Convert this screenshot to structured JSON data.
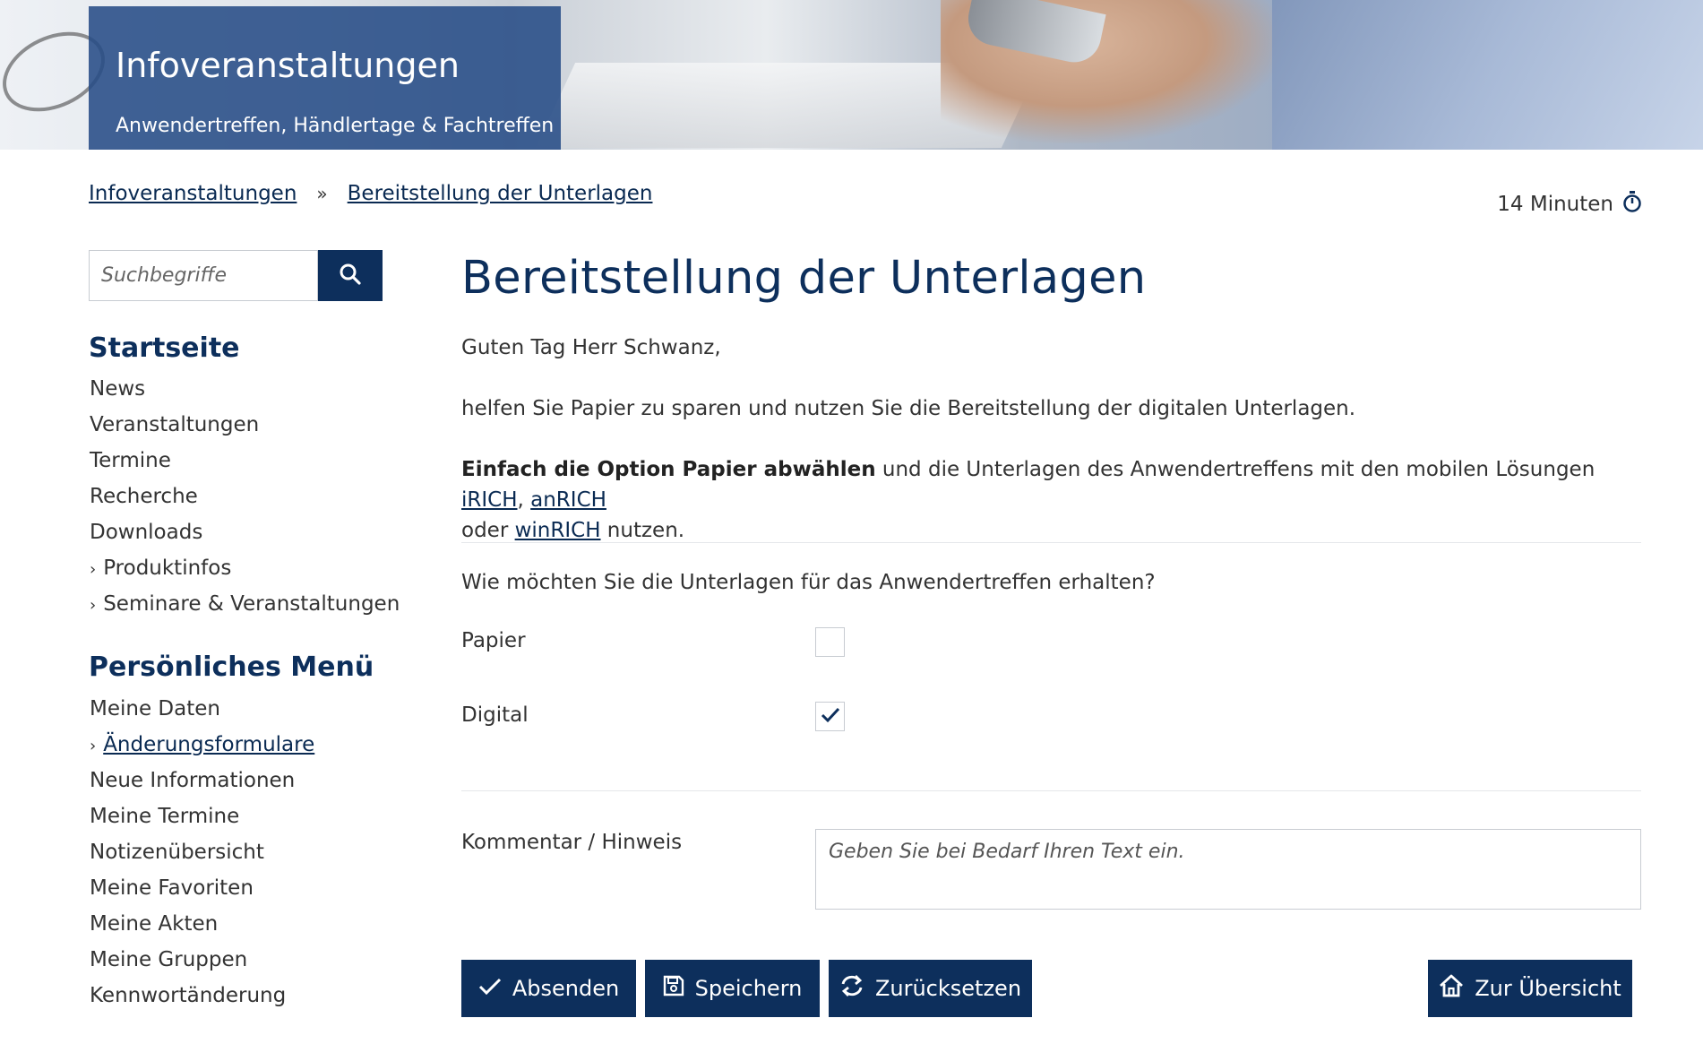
{
  "hero": {
    "title": "Infoveranstaltungen",
    "subtitle": "Anwendertreffen, Händlertage & Fachtreffen"
  },
  "breadcrumb": {
    "items": [
      "Infoveranstaltungen",
      "Bereitstellung der Unterlagen"
    ],
    "separator": "»"
  },
  "timer": {
    "label": "14 Minuten",
    "icon": "stopwatch-icon"
  },
  "search": {
    "placeholder": "Suchbegriffe",
    "icon": "search-icon"
  },
  "sidebar": {
    "main_heading": "Startseite",
    "main_items": [
      {
        "label": "News",
        "chevron": false
      },
      {
        "label": "Veranstaltungen",
        "chevron": false
      },
      {
        "label": "Termine",
        "chevron": false
      },
      {
        "label": "Recherche",
        "chevron": false
      },
      {
        "label": "Downloads",
        "chevron": false
      },
      {
        "label": "Produktinfos",
        "chevron": true
      },
      {
        "label": "Seminare & Veranstaltungen",
        "chevron": true
      }
    ],
    "personal_heading": "Persönliches Menü",
    "personal_items": [
      {
        "label": "Meine Daten",
        "chevron": false
      },
      {
        "label": "Änderungsformulare",
        "chevron": true,
        "active": true
      },
      {
        "label": "Neue Informationen",
        "chevron": false
      },
      {
        "label": "Meine Termine",
        "chevron": false
      },
      {
        "label": "Notizenübersicht",
        "chevron": false
      },
      {
        "label": "Meine Favoriten",
        "chevron": false
      },
      {
        "label": "Meine Akten",
        "chevron": false
      },
      {
        "label": "Meine Gruppen",
        "chevron": false
      },
      {
        "label": "Kennwortänderung",
        "chevron": false
      }
    ],
    "chevron_glyph": "›"
  },
  "main": {
    "title": "Bereitstellung der Unterlagen",
    "greeting": "Guten Tag Herr Schwanz,",
    "intro": "helfen Sie Papier zu sparen und nutzen Sie die Bereitstellung der digitalen Unterlagen.",
    "option_bold": "Einfach die Option Papier abwählen",
    "option_text": " und die Unterlagen des Anwendertreffens mit den mobilen Lösungen ",
    "link_irich": "iRICH",
    "comma": ", ",
    "link_anrich": "anRICH",
    "or_text": "oder ",
    "link_winrich": "winRICH",
    "end_text": " nutzen.",
    "question": "Wie möchten Sie die Unterlagen für das Anwendertreffen erhalten?",
    "options": [
      {
        "label": "Papier",
        "checked": false
      },
      {
        "label": "Digital",
        "checked": true
      }
    ],
    "comment_label": "Kommentar / Hinweis",
    "comment_placeholder": "Geben Sie bei Bedarf Ihren Text ein.",
    "comment_value": ""
  },
  "buttons": {
    "submit": "Absenden",
    "save": "Speichern",
    "reset": "Zurücksetzen",
    "overview": "Zur Übersicht"
  },
  "colors": {
    "primary": "#0d2f5c",
    "hero_box": "#274c86",
    "text": "#333333",
    "link": "#0a2a52",
    "border": "#c8ccd2"
  }
}
